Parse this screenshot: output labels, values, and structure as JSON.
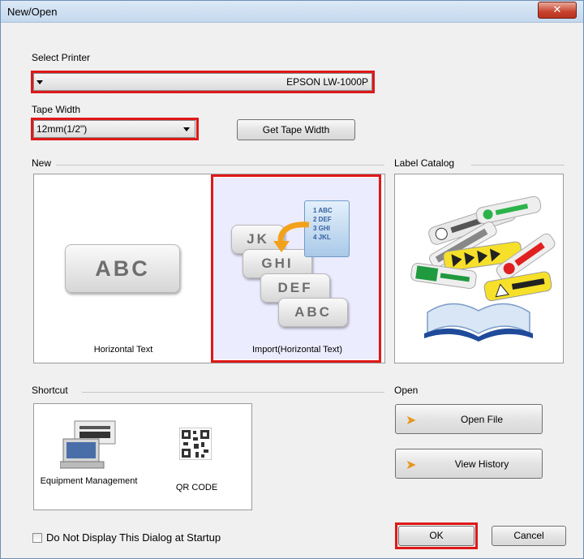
{
  "window": {
    "title": "New/Open",
    "close_icon": "close-icon"
  },
  "printer": {
    "label": "Select Printer",
    "value": "EPSON LW-1000P"
  },
  "tape": {
    "label": "Tape Width",
    "value": "12mm(1/2\")",
    "get_button": "Get Tape Width"
  },
  "new_section": {
    "label": "New",
    "tiles": [
      {
        "label": "Horizontal Text",
        "card_text": "ABC"
      },
      {
        "label": "Import(Horizontal Text)",
        "cards": [
          "JK",
          "GHI",
          "DEF",
          "ABC"
        ],
        "doc_lines": [
          "1 ABC",
          "2 DEF",
          "3 GHI",
          "4 JKL"
        ]
      }
    ]
  },
  "catalog": {
    "label": "Label Catalog"
  },
  "shortcut": {
    "label": "Shortcut",
    "items": [
      {
        "label": "Equipment Management"
      },
      {
        "label": "QR CODE"
      }
    ]
  },
  "open": {
    "label": "Open",
    "open_file": "Open File",
    "view_history": "View History"
  },
  "footer": {
    "checkbox_label": "Do Not Display This Dialog at Startup",
    "ok": "OK",
    "cancel": "Cancel"
  },
  "colors": {
    "highlight_red": "#e01818",
    "selected_tile_bg": "#ececff"
  }
}
